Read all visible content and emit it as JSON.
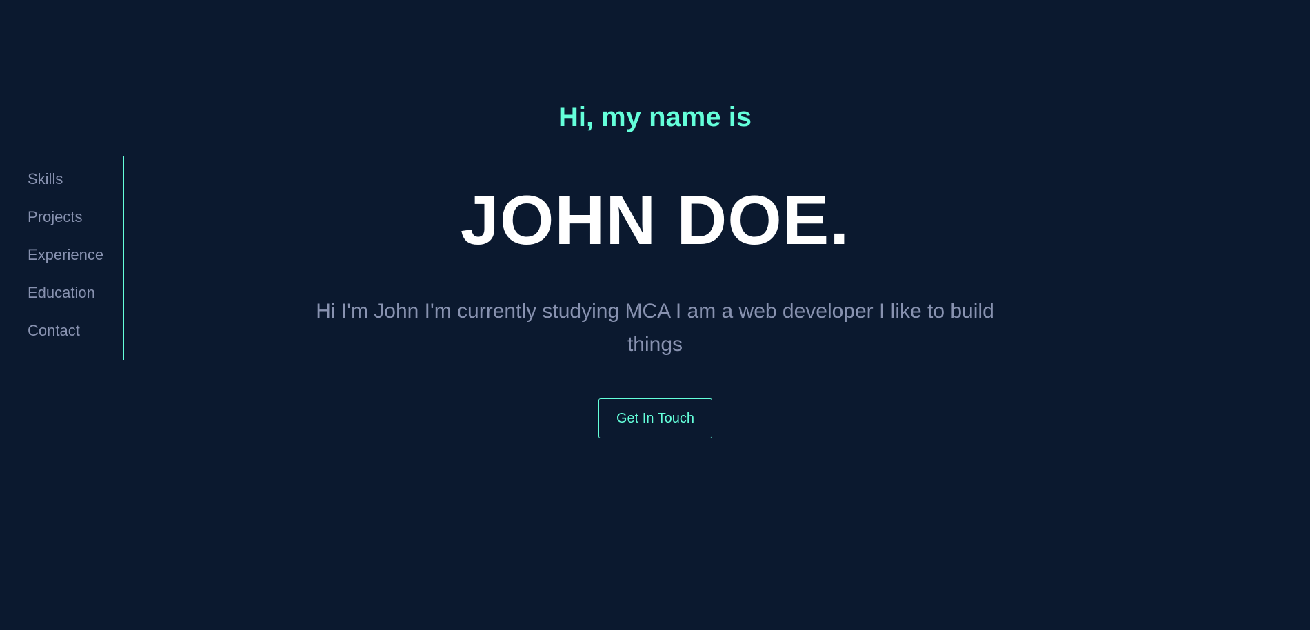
{
  "nav": {
    "items": [
      {
        "label": "Skills"
      },
      {
        "label": "Projects"
      },
      {
        "label": "Experience"
      },
      {
        "label": "Education"
      },
      {
        "label": "Contact"
      }
    ]
  },
  "hero": {
    "greeting": "Hi, my name is",
    "name": "JOHN DOE.",
    "bio": "Hi I'm John I'm currently studying MCA I am a web developer I like to build things",
    "cta_label": "Get In Touch"
  },
  "colors": {
    "background": "#0b192f",
    "accent": "#64ffda",
    "muted_text": "#8892b0",
    "heading_text": "#ffffff"
  }
}
